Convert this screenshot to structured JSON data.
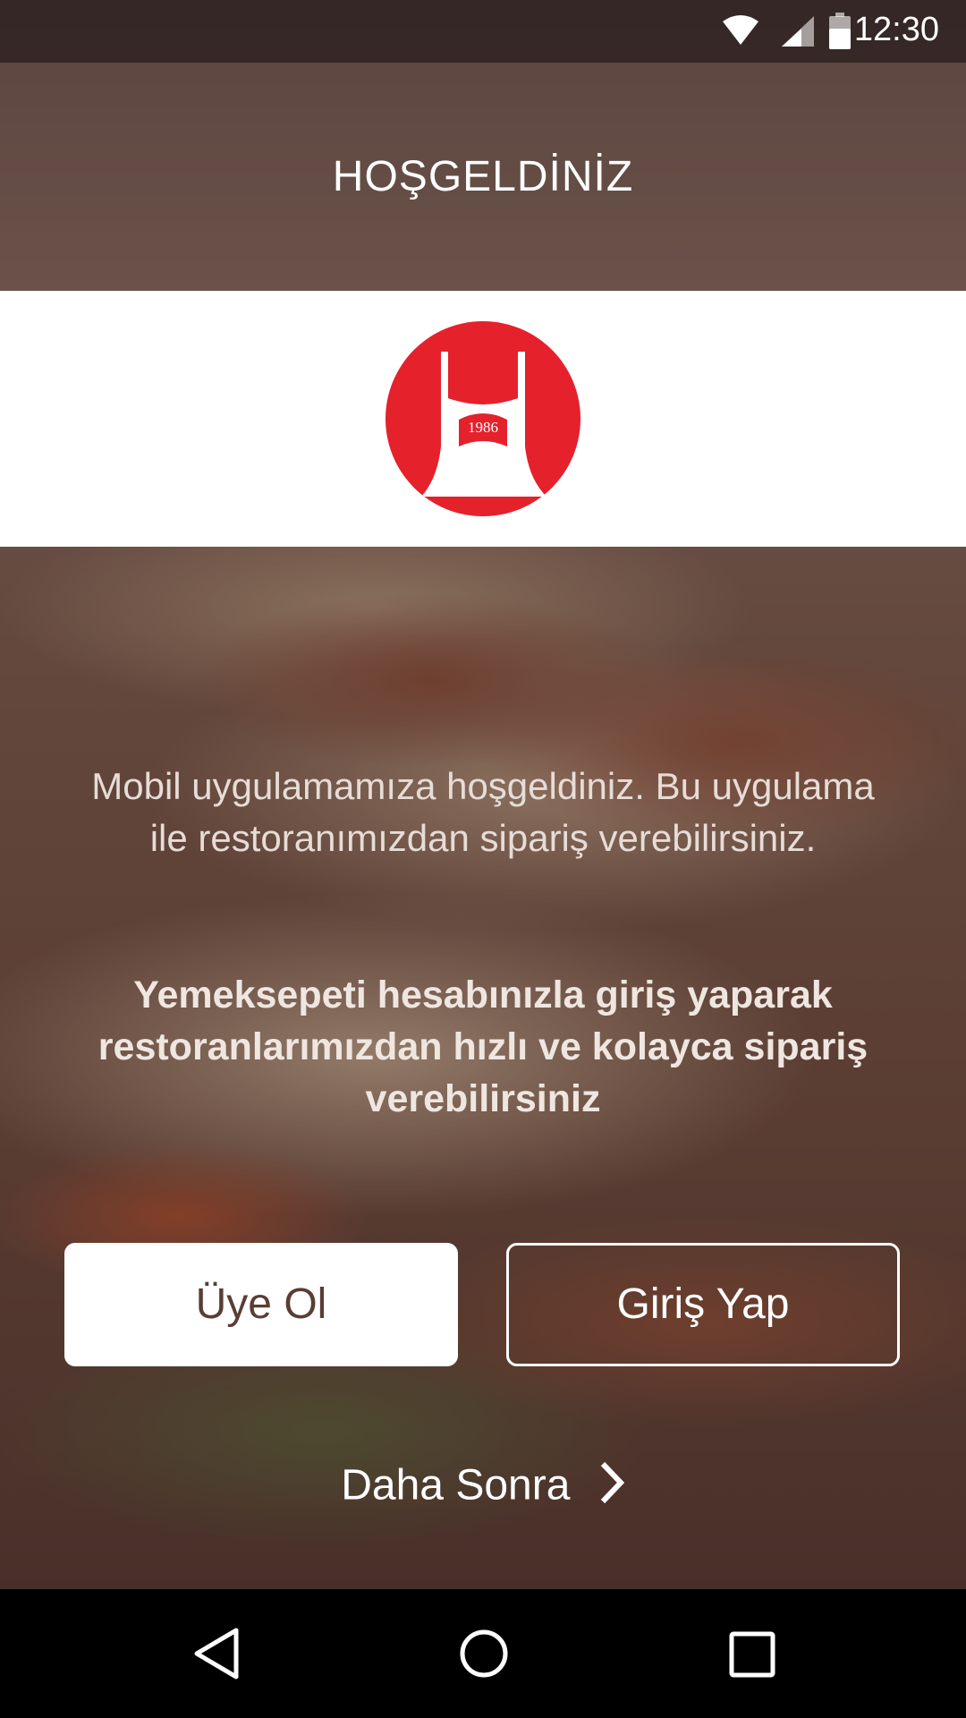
{
  "status_bar": {
    "time": "12:30"
  },
  "header": {
    "title": "HOŞGELDİNİZ"
  },
  "logo": {
    "year": "1986",
    "color": "#e5212c"
  },
  "intro": {
    "text": "Mobil uygulamamıza hoşgeldiniz. Bu uygulama ile restoranımızdan sipariş verebilirsiniz.",
    "bold_text": "Yemeksepeti hesabınızla giriş yaparak restoranlarımızdan hızlı ve kolayca sipariş verebilirsiniz"
  },
  "buttons": {
    "register": "Üye Ol",
    "login": "Giriş Yap",
    "later": "Daha Sonra"
  },
  "icons": {
    "wifi": "wifi-icon",
    "signal": "signal-icon",
    "battery": "battery-icon",
    "chevron": "chevron-right-icon"
  }
}
